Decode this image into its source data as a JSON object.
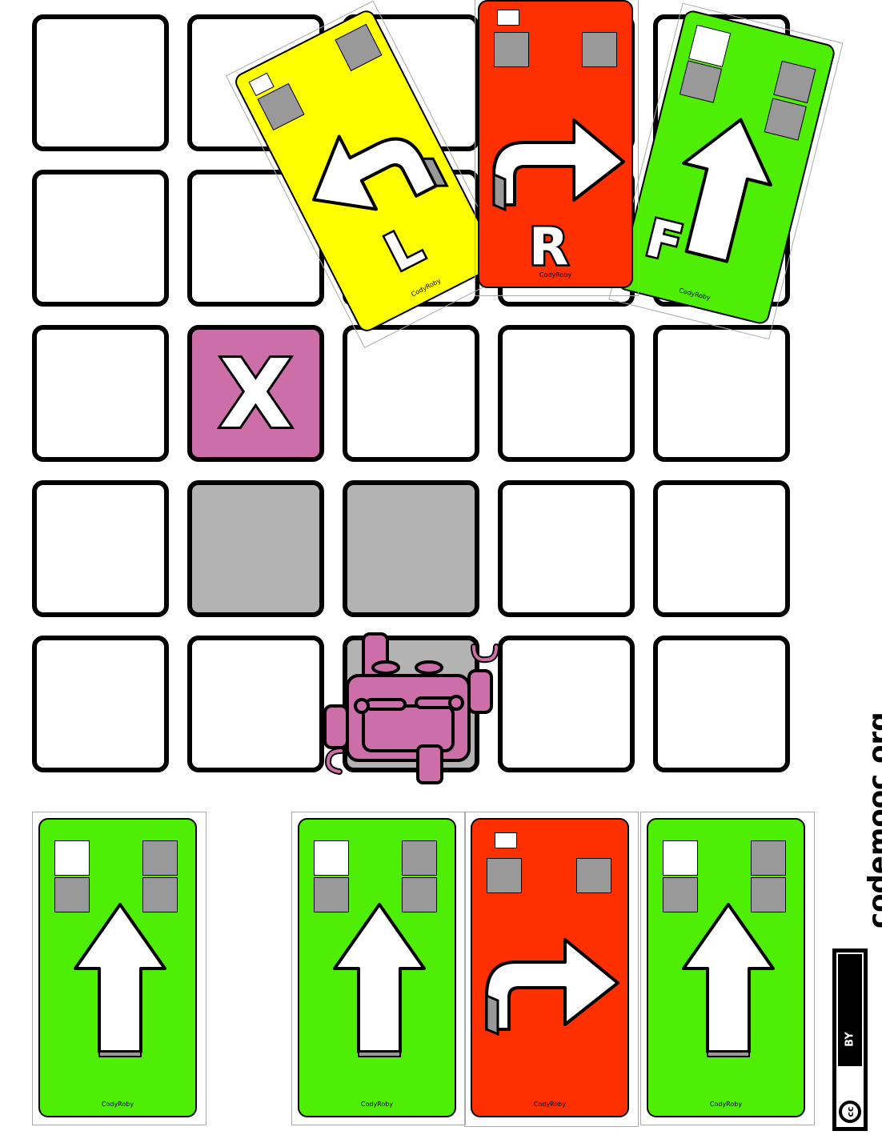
{
  "board": {
    "rows": 5,
    "cols": 5,
    "goal_letter": "X",
    "colors": {
      "cell": "#ffffff",
      "gray": "#b3b3b3",
      "goal": "#cc6fa8",
      "robot": "#cc6fa8"
    }
  },
  "cards": {
    "brand": "CodyRoby",
    "forward_letter": "F",
    "right_letter": "R",
    "left_letter": "L",
    "colors": {
      "forward": "#4eef05",
      "right": "#fe2f00",
      "left": "#ffff00"
    },
    "hand": [
      "forward",
      "forward",
      "right",
      "forward"
    ]
  },
  "footer": {
    "site": "codemooc.org",
    "license_cc": "cc",
    "license_by": "BY"
  }
}
